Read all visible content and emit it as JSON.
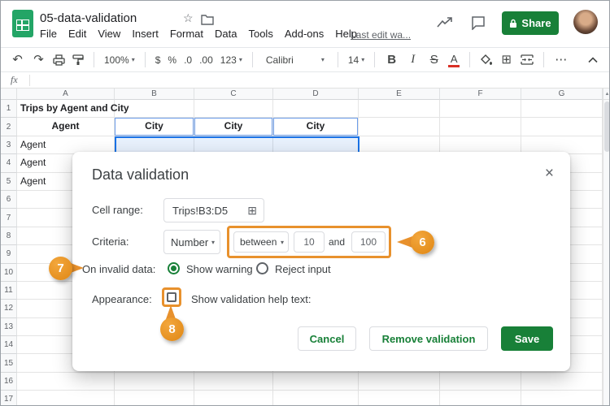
{
  "header": {
    "title": "05-data-validation",
    "menus": [
      "File",
      "Edit",
      "View",
      "Insert",
      "Format",
      "Data",
      "Tools",
      "Add-ons",
      "Help"
    ],
    "last_edit": "Last edit wa...",
    "share_label": "Share"
  },
  "toolbar": {
    "zoom": "100%",
    "currency": "$",
    "percent": "%",
    "decimal_decrease": ".0",
    "decimal_increase": ".00",
    "more_formats": "123",
    "font": "Calibri",
    "font_size": "14",
    "bold": "B",
    "italic": "I",
    "strikethrough": "S",
    "text_color": "A"
  },
  "formula_bar": {
    "fx": "fx"
  },
  "sheet": {
    "col_headers": [
      "A",
      "B",
      "C",
      "D",
      "E",
      "F",
      "G"
    ],
    "num_rows": 17,
    "cells": [
      {
        "row": 1,
        "col": "A",
        "text": "Trips by Agent and City",
        "bold": true,
        "align": "left",
        "spill": true
      },
      {
        "row": 2,
        "col": "A",
        "text": "Agent",
        "bold": true,
        "align": "center"
      },
      {
        "row": 2,
        "col": "B",
        "text": "City",
        "bold": true,
        "align": "center",
        "bordered": true
      },
      {
        "row": 2,
        "col": "C",
        "text": "City",
        "bold": true,
        "align": "center",
        "bordered": true
      },
      {
        "row": 2,
        "col": "D",
        "text": "City",
        "bold": true,
        "align": "center",
        "bordered": true
      },
      {
        "row": 3,
        "col": "A",
        "text": "Agent",
        "align": "left"
      },
      {
        "row": 4,
        "col": "A",
        "text": "Agent",
        "align": "left"
      },
      {
        "row": 5,
        "col": "A",
        "text": "Agent",
        "align": "left"
      }
    ],
    "selection_range": "B3:D5"
  },
  "dialog": {
    "title": "Data validation",
    "cell_range_label": "Cell range:",
    "cell_range_value": "Trips!B3:D5",
    "criteria_label": "Criteria:",
    "criteria_type": "Number",
    "criteria_operator": "between",
    "min_value": "10",
    "and_label": "and",
    "max_value": "100",
    "invalid_label": "On invalid data:",
    "option_show_warning": "Show warning",
    "option_reject_input": "Reject input",
    "appearance_label": "Appearance:",
    "help_text_label": "Show validation help text:",
    "cancel_label": "Cancel",
    "remove_label": "Remove validation",
    "save_label": "Save"
  },
  "callouts": {
    "six": "6",
    "seven": "7",
    "eight": "8"
  },
  "icons": {
    "undo": "↶",
    "redo": "↷",
    "star": "☆",
    "caret": "▾",
    "borders": "⊞",
    "range_grid": "⊞",
    "more": "⋯",
    "close": "×",
    "scroll_up": "▲"
  },
  "colors": {
    "accent_green": "#188038",
    "annotation_orange": "#e8912d",
    "selection_blue": "#1a73e8"
  }
}
